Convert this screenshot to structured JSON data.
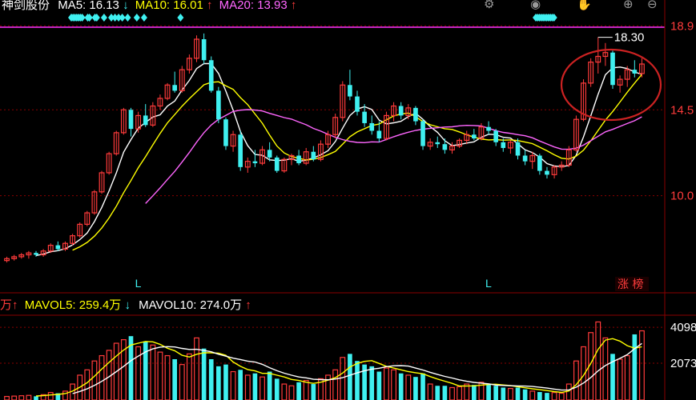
{
  "header": {
    "stock_name": "神剑股份",
    "ma5_label": "MA5: 16.13",
    "ma5_arrow": "↓",
    "ma10_label": "MA10: 16.01",
    "ma10_arrow": "↑",
    "ma20_label": "MA20: 13.93",
    "ma20_arrow": "↑"
  },
  "toolbar": {
    "icons": [
      "gear-icon",
      "eye-icon",
      "hand-icon",
      "plus-icon",
      "minus-icon"
    ],
    "buttons": [
      "⚙",
      "◉",
      "✋",
      "⊕",
      "⊖"
    ]
  },
  "price_axis": {
    "ticks": [
      {
        "value": 18.9,
        "label": "18.9"
      },
      {
        "value": 14.5,
        "label": "14.5"
      },
      {
        "value": 10.0,
        "label": "10.0"
      }
    ],
    "high_marker": "18.30"
  },
  "low_markers": [
    "L",
    "L"
  ],
  "limit_badge": "涨 榜",
  "volume_header": {
    "prefix": "万↑",
    "mavol5_label": "MAVOL5: 259.4万",
    "mavol5_arrow": "↓",
    "mavol10_label": "MAVOL10: 274.0万",
    "mavol10_arrow": "↑"
  },
  "volume_axis": {
    "ticks": [
      {
        "value": 4098,
        "label": "4098"
      },
      {
        "value": 2073,
        "label": "2073"
      }
    ]
  },
  "colors": {
    "up": "#ff3b3b",
    "down": "#3ff0f0",
    "ma5": "#ffffff",
    "ma10": "#ffff00",
    "ma20": "#ff66ff",
    "grid": "#8a0000",
    "axis_text": "#ff3b3b",
    "circle": "#cc2222"
  },
  "chart_data": {
    "type": "candlestick",
    "ylim": [
      6.0,
      19.5
    ],
    "volume_ylim": [
      0,
      4600
    ],
    "candles": [
      [
        6.6,
        6.8,
        6.5,
        6.7,
        200
      ],
      [
        6.7,
        6.9,
        6.6,
        6.8,
        220
      ],
      [
        6.8,
        7.0,
        6.7,
        6.9,
        240
      ],
      [
        6.9,
        7.1,
        6.7,
        7.0,
        260
      ],
      [
        7.0,
        7.1,
        6.8,
        6.9,
        210
      ],
      [
        6.9,
        7.2,
        6.8,
        7.1,
        300
      ],
      [
        7.1,
        7.5,
        7.0,
        7.4,
        420
      ],
      [
        7.4,
        7.6,
        7.1,
        7.2,
        380
      ],
      [
        7.2,
        7.6,
        7.1,
        7.5,
        500
      ],
      [
        7.5,
        8.0,
        7.4,
        7.9,
        900
      ],
      [
        7.9,
        8.6,
        7.8,
        8.5,
        1400
      ],
      [
        8.5,
        9.2,
        8.4,
        9.1,
        1700
      ],
      [
        9.1,
        10.3,
        9.0,
        10.2,
        2200
      ],
      [
        10.2,
        11.3,
        10.1,
        11.2,
        2500
      ],
      [
        11.2,
        12.3,
        11.1,
        12.2,
        2800
      ],
      [
        12.2,
        13.4,
        12.1,
        13.3,
        3200
      ],
      [
        13.3,
        14.6,
        13.2,
        14.5,
        3400
      ],
      [
        14.5,
        14.6,
        13.1,
        13.5,
        3600
      ],
      [
        13.5,
        14.4,
        13.3,
        14.2,
        3000
      ],
      [
        14.2,
        14.8,
        13.6,
        13.7,
        3300
      ],
      [
        13.7,
        14.9,
        13.6,
        14.7,
        3100
      ],
      [
        14.7,
        15.3,
        14.5,
        15.1,
        2700
      ],
      [
        15.1,
        15.9,
        15.0,
        15.8,
        2500
      ],
      [
        15.8,
        16.5,
        15.4,
        15.5,
        2300
      ],
      [
        15.5,
        16.8,
        15.4,
        16.6,
        2000
      ],
      [
        16.6,
        17.4,
        16.4,
        17.2,
        2600
      ],
      [
        17.2,
        18.4,
        17.0,
        18.2,
        3500
      ],
      [
        18.2,
        18.5,
        16.9,
        17.1,
        2900
      ],
      [
        17.1,
        17.3,
        15.4,
        15.5,
        2300
      ],
      [
        15.5,
        15.7,
        13.8,
        14.0,
        1900
      ],
      [
        14.0,
        14.1,
        12.4,
        12.6,
        2000
      ],
      [
        12.6,
        13.4,
        12.3,
        13.2,
        1600
      ],
      [
        13.2,
        13.4,
        11.3,
        11.5,
        1700
      ],
      [
        11.5,
        12.0,
        11.2,
        11.8,
        1400
      ],
      [
        11.8,
        12.4,
        11.5,
        11.7,
        1500
      ],
      [
        11.7,
        12.6,
        11.6,
        12.4,
        1300
      ],
      [
        12.4,
        12.8,
        11.8,
        12.0,
        1600
      ],
      [
        12.0,
        12.1,
        11.2,
        11.3,
        1200
      ],
      [
        11.3,
        12.0,
        11.2,
        11.9,
        900
      ],
      [
        11.9,
        12.2,
        11.6,
        12.1,
        800
      ],
      [
        12.1,
        12.4,
        11.6,
        11.7,
        1000
      ],
      [
        11.7,
        12.5,
        11.6,
        12.3,
        1100
      ],
      [
        12.3,
        12.6,
        11.8,
        11.9,
        900
      ],
      [
        11.9,
        12.9,
        11.8,
        12.7,
        1200
      ],
      [
        12.7,
        13.4,
        12.5,
        13.2,
        1400
      ],
      [
        13.2,
        14.3,
        13.0,
        14.1,
        1700
      ],
      [
        14.1,
        16.0,
        13.9,
        15.8,
        2400
      ],
      [
        15.8,
        16.6,
        15.0,
        15.2,
        2600
      ],
      [
        15.2,
        15.5,
        14.2,
        14.4,
        2200
      ],
      [
        14.4,
        14.8,
        13.6,
        13.8,
        2000
      ],
      [
        13.8,
        14.2,
        13.2,
        13.4,
        1900
      ],
      [
        13.4,
        13.9,
        12.8,
        13.0,
        1600
      ],
      [
        13.0,
        14.4,
        12.9,
        14.2,
        1800
      ],
      [
        14.2,
        14.9,
        13.9,
        14.7,
        1700
      ],
      [
        14.7,
        14.9,
        14.0,
        14.2,
        1500
      ],
      [
        14.2,
        14.8,
        14.0,
        14.6,
        1400
      ],
      [
        14.6,
        14.7,
        13.7,
        13.9,
        1300
      ],
      [
        13.9,
        14.0,
        12.4,
        12.6,
        1500
      ],
      [
        12.6,
        13.0,
        12.4,
        12.8,
        900
      ],
      [
        12.8,
        13.1,
        12.5,
        12.7,
        800
      ],
      [
        12.7,
        13.0,
        12.2,
        12.4,
        800
      ],
      [
        12.4,
        12.8,
        12.2,
        12.6,
        700
      ],
      [
        12.6,
        13.0,
        12.5,
        12.9,
        750
      ],
      [
        12.9,
        13.4,
        12.7,
        13.2,
        900
      ],
      [
        13.2,
        13.5,
        12.9,
        13.0,
        850
      ],
      [
        13.0,
        13.8,
        12.9,
        13.6,
        1000
      ],
      [
        13.6,
        13.9,
        13.2,
        13.4,
        900
      ],
      [
        13.4,
        13.5,
        12.6,
        12.8,
        800
      ],
      [
        12.8,
        13.0,
        12.3,
        12.5,
        700
      ],
      [
        12.5,
        12.9,
        12.2,
        12.8,
        650
      ],
      [
        12.8,
        13.0,
        11.9,
        12.1,
        700
      ],
      [
        12.1,
        12.4,
        11.6,
        11.8,
        600
      ],
      [
        11.8,
        12.3,
        11.4,
        12.1,
        500
      ],
      [
        12.1,
        12.2,
        11.1,
        11.3,
        450
      ],
      [
        11.3,
        11.5,
        10.9,
        11.1,
        400
      ],
      [
        11.1,
        11.6,
        10.9,
        11.5,
        420
      ],
      [
        11.5,
        11.8,
        11.3,
        11.6,
        380
      ],
      [
        11.6,
        12.6,
        11.5,
        12.4,
        900
      ],
      [
        12.4,
        14.2,
        12.3,
        14.0,
        2200
      ],
      [
        14.0,
        16.1,
        13.9,
        15.9,
        3000
      ],
      [
        15.9,
        17.2,
        15.7,
        17.0,
        3800
      ],
      [
        17.0,
        18.3,
        16.4,
        17.3,
        4400
      ],
      [
        17.3,
        18.0,
        16.8,
        17.5,
        3500
      ],
      [
        17.5,
        17.6,
        15.6,
        15.8,
        2600
      ],
      [
        15.8,
        16.3,
        15.4,
        16.1,
        2300
      ],
      [
        16.1,
        16.8,
        15.7,
        16.6,
        2500
      ],
      [
        16.6,
        17.1,
        16.2,
        16.4,
        3700
      ],
      [
        16.4,
        17.2,
        16.2,
        16.9,
        3900
      ]
    ],
    "ma_series": [
      {
        "name": "MA5",
        "period": 5
      },
      {
        "name": "MA10",
        "period": 10
      },
      {
        "name": "MA20",
        "period": 20
      }
    ],
    "mavol_series": [
      {
        "name": "MAVOL5",
        "period": 5
      },
      {
        "name": "MAVOL10",
        "period": 10
      }
    ],
    "low_marker_indices": [
      18,
      66
    ],
    "high_marker_index": 81
  }
}
